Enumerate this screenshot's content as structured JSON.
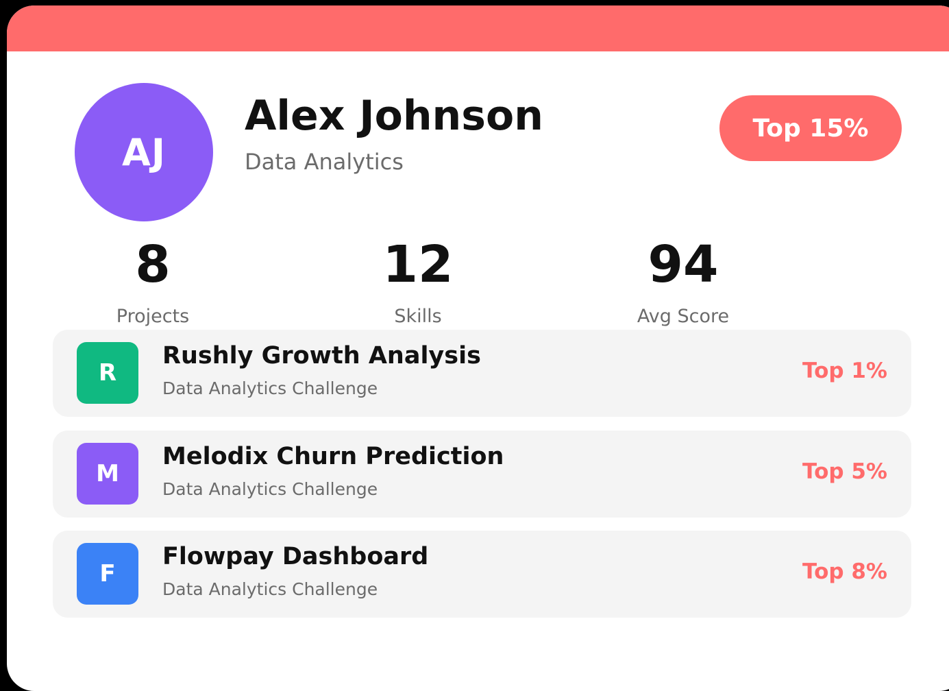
{
  "profile": {
    "initials": "AJ",
    "name": "Alex Johnson",
    "field": "Data Analytics",
    "rank": "Top 15%"
  },
  "stats": [
    {
      "value": "8",
      "label": "Projects"
    },
    {
      "value": "12",
      "label": "Skills"
    },
    {
      "value": "94",
      "label": "Avg Score"
    }
  ],
  "projects": [
    {
      "initial": "R",
      "title": "Rushly Growth Analysis",
      "subtitle": "Data Analytics Challenge",
      "rank": "Top 1%",
      "color": "#10b981"
    },
    {
      "initial": "M",
      "title": "Melodix Churn Prediction",
      "subtitle": "Data Analytics Challenge",
      "rank": "Top 5%",
      "color": "#8b5cf6"
    },
    {
      "initial": "F",
      "title": "Flowpay Dashboard",
      "subtitle": "Data Analytics Challenge",
      "rank": "Top 8%",
      "color": "#3b82f6"
    }
  ],
  "colors": {
    "accent": "#ff6b6b",
    "avatar": "#8b5cf6"
  }
}
